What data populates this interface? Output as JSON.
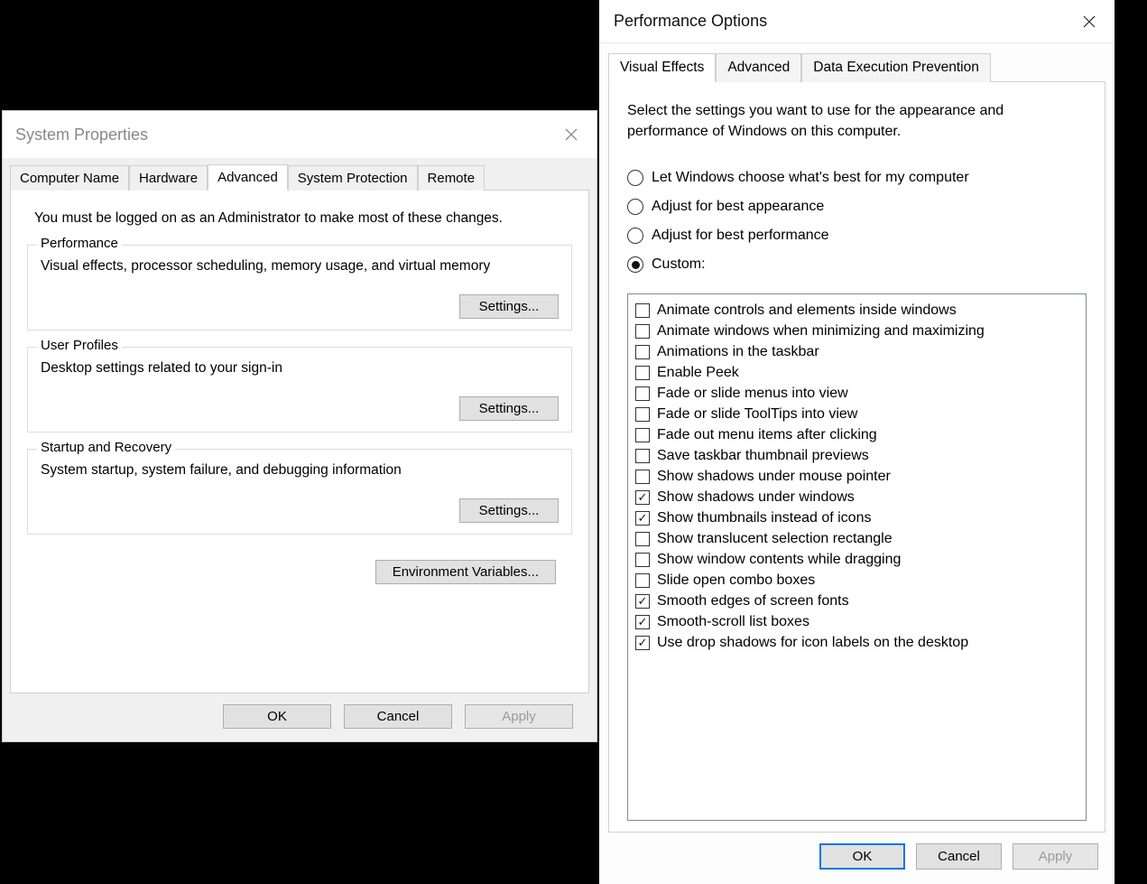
{
  "sysprop": {
    "title": "System Properties",
    "tabs": [
      {
        "label": "Computer Name"
      },
      {
        "label": "Hardware"
      },
      {
        "label": "Advanced"
      },
      {
        "label": "System Protection"
      },
      {
        "label": "Remote"
      }
    ],
    "active_tab": 2,
    "intro": "You must be logged on as an Administrator to make most of these changes.",
    "groups": {
      "performance": {
        "title": "Performance",
        "desc": "Visual effects, processor scheduling, memory usage, and virtual memory",
        "button": "Settings..."
      },
      "user_profiles": {
        "title": "User Profiles",
        "desc": "Desktop settings related to your sign-in",
        "button": "Settings..."
      },
      "startup": {
        "title": "Startup and Recovery",
        "desc": "System startup, system failure, and debugging information",
        "button": "Settings..."
      }
    },
    "env_button": "Environment Variables...",
    "footer": {
      "ok": "OK",
      "cancel": "Cancel",
      "apply": "Apply"
    }
  },
  "perf": {
    "title": "Performance Options",
    "tabs": [
      {
        "label": "Visual Effects"
      },
      {
        "label": "Advanced"
      },
      {
        "label": "Data Execution Prevention"
      }
    ],
    "active_tab": 0,
    "intro": "Select the settings you want to use for the appearance and performance of Windows on this computer.",
    "radios": [
      {
        "label": "Let Windows choose what's best for my computer",
        "selected": false
      },
      {
        "label": "Adjust for best appearance",
        "selected": false
      },
      {
        "label": "Adjust for best performance",
        "selected": false
      },
      {
        "label": "Custom:",
        "selected": true
      }
    ],
    "checks": [
      {
        "label": "Animate controls and elements inside windows",
        "checked": false
      },
      {
        "label": "Animate windows when minimizing and maximizing",
        "checked": false
      },
      {
        "label": "Animations in the taskbar",
        "checked": false
      },
      {
        "label": "Enable Peek",
        "checked": false
      },
      {
        "label": "Fade or slide menus into view",
        "checked": false
      },
      {
        "label": "Fade or slide ToolTips into view",
        "checked": false
      },
      {
        "label": "Fade out menu items after clicking",
        "checked": false
      },
      {
        "label": "Save taskbar thumbnail previews",
        "checked": false
      },
      {
        "label": "Show shadows under mouse pointer",
        "checked": false
      },
      {
        "label": "Show shadows under windows",
        "checked": true
      },
      {
        "label": "Show thumbnails instead of icons",
        "checked": true
      },
      {
        "label": "Show translucent selection rectangle",
        "checked": false
      },
      {
        "label": "Show window contents while dragging",
        "checked": false
      },
      {
        "label": "Slide open combo boxes",
        "checked": false
      },
      {
        "label": "Smooth edges of screen fonts",
        "checked": true
      },
      {
        "label": "Smooth-scroll list boxes",
        "checked": true
      },
      {
        "label": "Use drop shadows for icon labels on the desktop",
        "checked": true
      }
    ],
    "footer": {
      "ok": "OK",
      "cancel": "Cancel",
      "apply": "Apply"
    }
  }
}
